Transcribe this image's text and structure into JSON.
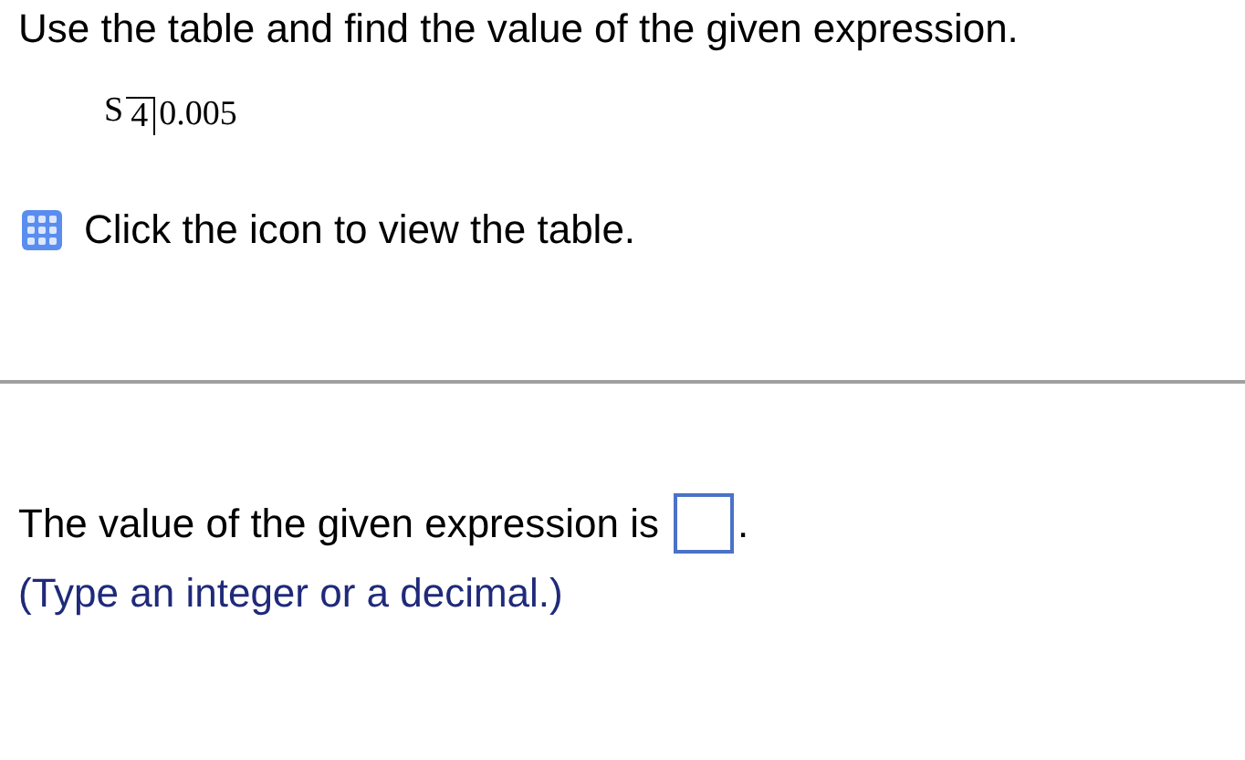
{
  "instruction": "Use the table and find the value of the given expression.",
  "expression": {
    "symbol": "S",
    "term": "4",
    "rate": "0.005"
  },
  "table_link": {
    "label": "Click the icon to view the table."
  },
  "answer": {
    "prompt": "The value of the given expression is",
    "end": ".",
    "hint": "(Type an integer or a decimal.)"
  }
}
